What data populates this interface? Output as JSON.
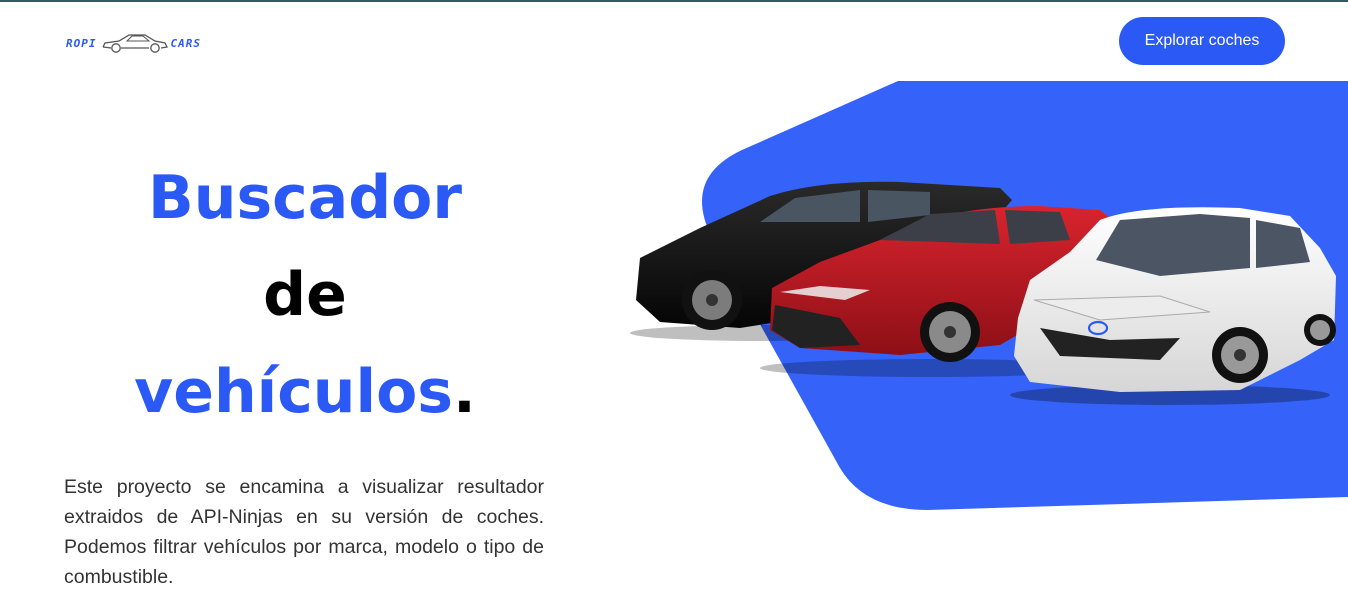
{
  "header": {
    "logo_left": "ROPI",
    "logo_right": "CARS",
    "cta_label": "Explorar coches"
  },
  "hero": {
    "line1": "Buscador",
    "line2": "de",
    "line3": "vehículos",
    "line3_punct": ".",
    "description": "Este proyecto se encamina a visualizar resultador extraidos de API-Ninjas en su versión de coches. Podemos filtrar vehículos por marca, modelo o tipo de combustible."
  },
  "colors": {
    "accent": "#2b59f5",
    "shape": "#3563fa",
    "text": "#333333"
  },
  "icons": {
    "logo_car": "car-outline-icon"
  },
  "image": {
    "subject": "three-cars-illustration",
    "cars": [
      "black-suv",
      "red-sedan",
      "white-hatchback"
    ]
  }
}
